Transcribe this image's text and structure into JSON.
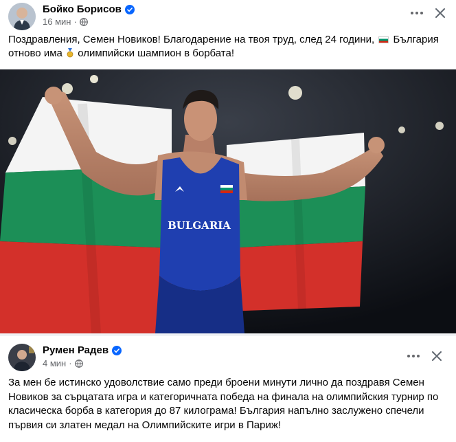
{
  "posts": [
    {
      "author": "Бойко Борисов",
      "time": "16 мин",
      "text_part1": "Поздравления, Семен Новиков! Благодарение на твоя труд, след 24 години, ",
      "text_part2": " България отново има ",
      "text_part3": " олимпийски шампион в борбата!",
      "photo_jersey_text": "BULGARIA"
    },
    {
      "author": "Румен Радев",
      "time": "4 мин",
      "text": "За мен бе истинско удоволствие само преди броени минути лично да поздравя Семен Новиков за сърцатата игра и категоричната победа на финала на олимпийския турнир по класическа борба в категория до 87 килограма! България напълно заслужено спечели първия си златен медал на Олимпийските игри в Париж!"
    }
  ],
  "icons": {
    "verified": "verified-badge-icon",
    "privacy": "globe-icon",
    "more": "more-horizontal-icon",
    "close": "close-icon"
  },
  "colors": {
    "verified_blue": "#0866ff",
    "meta_gray": "#65676b",
    "flag_white": "#ffffff",
    "flag_green": "#00966e",
    "flag_red": "#d62612",
    "jersey_blue": "#1f3fb0"
  }
}
